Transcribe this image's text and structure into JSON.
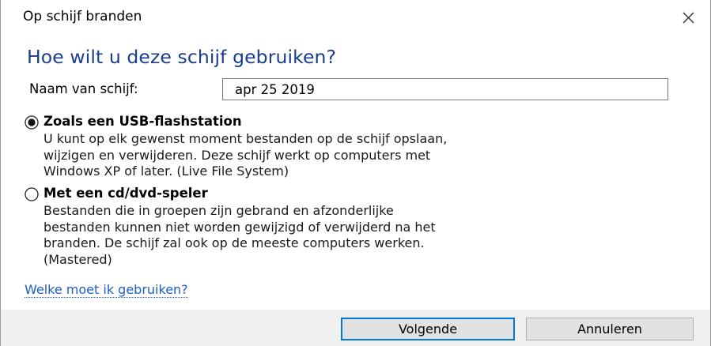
{
  "window": {
    "title": "Op schijf branden"
  },
  "heading": "Hoe wilt u deze schijf gebruiken?",
  "disc_name": {
    "label": "Naam van schijf:",
    "value": "apr 25 2019"
  },
  "options": [
    {
      "title": "Zoals een USB-flashstation",
      "selected": true,
      "description": [
        "U kunt op elk gewenst moment bestanden op de schijf opslaan,",
        "wijzigen en verwijderen. Deze schijf werkt op computers met",
        "Windows XP of later. (Live File System)"
      ]
    },
    {
      "title": "Met een cd/dvd-speler",
      "selected": false,
      "description": [
        "Bestanden die in groepen zijn gebrand en afzonderlijke",
        "bestanden kunnen niet worden gewijzigd of verwijderd na het",
        "branden. De schijf zal ook op de meeste computers werken.",
        "(Mastered)"
      ]
    }
  ],
  "help_link": "Welke moet ik gebruiken?",
  "buttons": {
    "next": "Volgende",
    "cancel": "Annuleren"
  },
  "icons": {
    "close": "close-icon",
    "radio_selected": "radio-selected-icon",
    "radio_unselected": "radio-unselected-icon"
  },
  "colors": {
    "heading": "#1a3d8f",
    "link": "#1d5fc7",
    "default_button_border": "#0078d7",
    "footer_background": "#f0f0f0"
  }
}
